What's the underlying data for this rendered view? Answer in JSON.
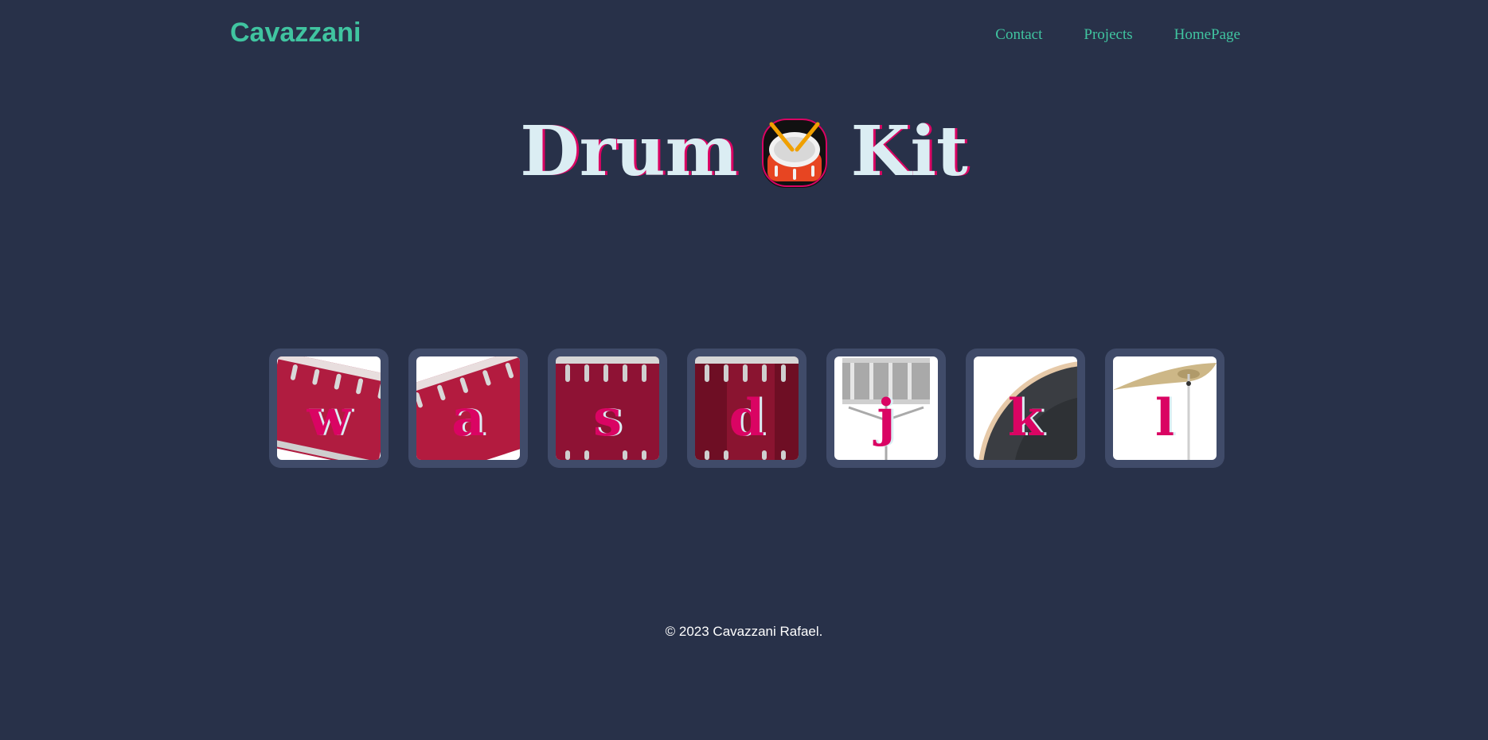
{
  "header": {
    "logo": "Cavazzani",
    "nav": [
      {
        "label": "Contact"
      },
      {
        "label": "Projects"
      },
      {
        "label": "HomePage"
      }
    ]
  },
  "title": {
    "before": "Drum",
    "icon": "drum-emoji-icon",
    "after": "Kit"
  },
  "pads": [
    {
      "key": "w",
      "drum": "tom-1"
    },
    {
      "key": "a",
      "drum": "tom-2"
    },
    {
      "key": "s",
      "drum": "tom-3"
    },
    {
      "key": "d",
      "drum": "tom-4"
    },
    {
      "key": "j",
      "drum": "snare"
    },
    {
      "key": "k",
      "drum": "kick"
    },
    {
      "key": "l",
      "drum": "crash"
    }
  ],
  "footer": {
    "text": "© 2023 Cavazzani Rafael."
  },
  "colors": {
    "background": "#283149",
    "accent": "#40c4a0",
    "pad_border": "#404b69",
    "key_color": "#da0463",
    "title_color": "#dbedf3"
  }
}
